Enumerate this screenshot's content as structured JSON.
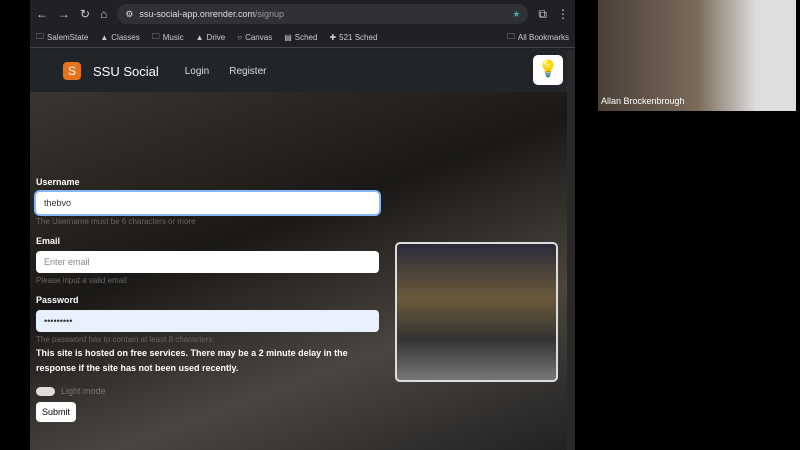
{
  "browser": {
    "url_host": "ssu-social-app.onrender.com",
    "url_path": "/signup",
    "bookmarks": [
      "SalemState",
      "Classes",
      "Music",
      "Drive",
      "Canvas",
      "Sched",
      "521 Sched"
    ],
    "all_bookmarks": "All Bookmarks"
  },
  "nav": {
    "brand": "SSU Social",
    "login": "Login",
    "register": "Register"
  },
  "form": {
    "username_label": "Username",
    "username_value": "thebvo",
    "username_help": "The Username must be 6 characters or more",
    "email_label": "Email",
    "email_placeholder": "Enter email",
    "email_help": "Please input a valid email",
    "password_label": "Password",
    "password_value": "•••••••••",
    "password_help": "The password has to contain at least 8 characters.",
    "notice": "This site is hosted on free services. There may be a 2 minute delay in the response if the site has not been used recently.",
    "light_mode": "Light mode",
    "submit": "Submit"
  },
  "video": {
    "participant": "Allan Brockenbrough"
  }
}
